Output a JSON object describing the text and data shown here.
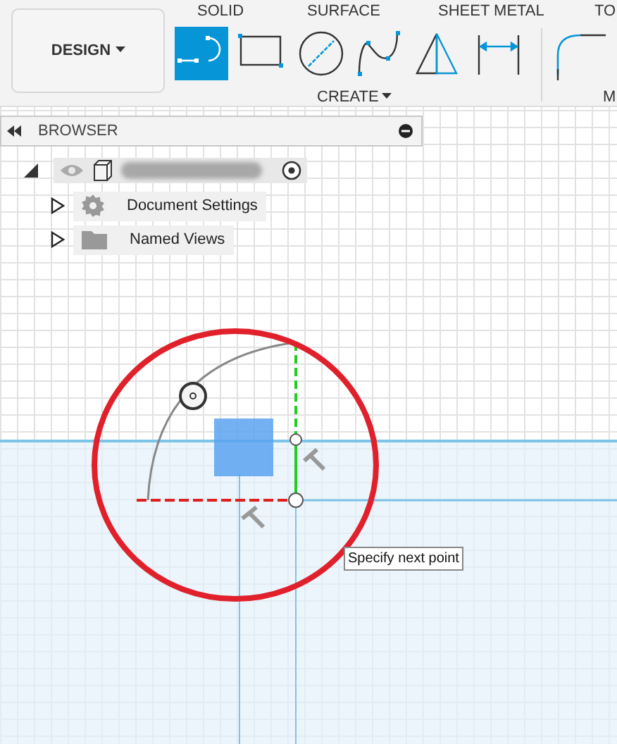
{
  "toolbar": {
    "workspace_button": "DESIGN",
    "tabs": [
      {
        "label": "SOLID"
      },
      {
        "label": "SURFACE"
      },
      {
        "label": "SHEET METAL"
      },
      {
        "label": "TO"
      }
    ],
    "tools": [
      {
        "kind": "line",
        "selected": true
      },
      {
        "kind": "rectangle",
        "selected": false
      },
      {
        "kind": "circle",
        "selected": false
      },
      {
        "kind": "spline",
        "selected": false
      },
      {
        "kind": "mirror",
        "selected": false
      },
      {
        "kind": "dimension",
        "selected": false
      },
      {
        "kind": "fillet",
        "selected": false
      }
    ],
    "groups": [
      {
        "label": "CREATE",
        "dropdown": true
      },
      {
        "label": "M"
      }
    ]
  },
  "browser": {
    "title": "BROWSER",
    "items": [
      {
        "kind": "component",
        "expanded": true,
        "children": [
          {
            "kind": "settings",
            "label": "Document Settings",
            "expanded": false
          },
          {
            "kind": "folder",
            "label": "Named Views",
            "expanded": false
          }
        ]
      }
    ]
  },
  "tooltip": "Specify next point"
}
